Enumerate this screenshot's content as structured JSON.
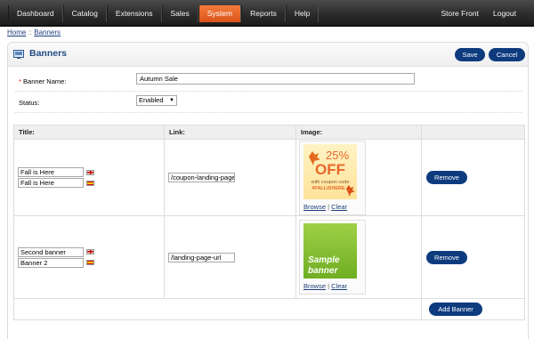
{
  "nav": {
    "items": [
      "Dashboard",
      "Catalog",
      "Extensions",
      "Sales",
      "System",
      "Reports",
      "Help"
    ],
    "active": "System",
    "right": [
      "Store Front",
      "Logout"
    ]
  },
  "breadcrumb": {
    "home": "Home",
    "sep": " :: ",
    "current": "Banners"
  },
  "heading": {
    "title": "Banners",
    "save": "Save",
    "cancel": "Cancel"
  },
  "form": {
    "name_label": "Banner Name:",
    "name_required": "*",
    "name_value": "Autumn Sale",
    "status_label": "Status:",
    "status_value": "Enabled"
  },
  "table": {
    "headers": [
      "Title:",
      "Link:",
      "Image:",
      ""
    ],
    "rows": [
      {
        "title_en": "Fall is Here",
        "title_es": "Fall is Here",
        "link": "/coupon-landing-page",
        "image": {
          "line1": "25%",
          "line2": "OFF",
          "line3": "with coupon code",
          "line4": "#FALLISHERE"
        },
        "browse": "Browse",
        "sep": "|",
        "clear": "Clear",
        "remove": "Remove"
      },
      {
        "title_en": "Second banner",
        "title_es": "Banner 2",
        "link": "/landing-page-url",
        "image": {
          "line1": "Sample",
          "line2": "banner"
        },
        "browse": "Browse",
        "sep": "|",
        "clear": "Clear",
        "remove": "Remove"
      }
    ],
    "add_banner": "Add Banner"
  },
  "colors": {
    "accent": "#0d3b7e",
    "active_tab": "#e8682b",
    "topbar": "#2b2b2b",
    "heading_text": "#1f4a82"
  }
}
